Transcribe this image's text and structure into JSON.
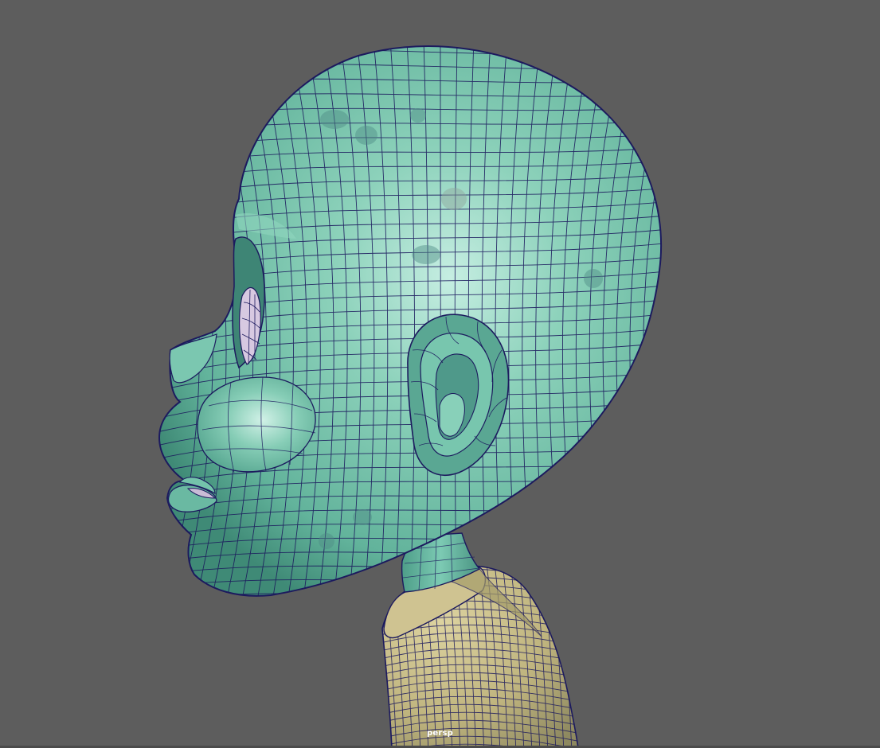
{
  "viewport": {
    "camera_label": "persp",
    "background_color": "#5d5d5d",
    "wire_color": "#1c1a5e",
    "head_color": "#6fc2a9",
    "head_highlight": "#c3ece0",
    "shirt_color": "#c7bb86",
    "shirt_shadow": "#8f8a60"
  }
}
